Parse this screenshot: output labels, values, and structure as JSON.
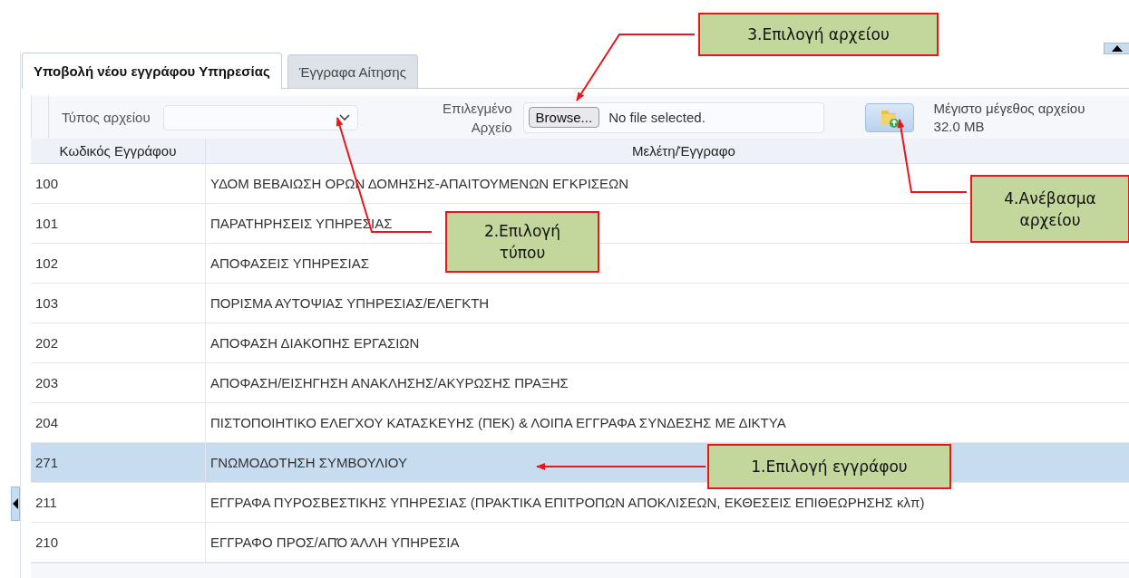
{
  "tabs": [
    {
      "label": "Υποβολή νέου εγγράφου Υπηρεσίας",
      "selected": true
    },
    {
      "label": "Έγγραφα Αίτησης",
      "selected": false
    }
  ],
  "toolbar": {
    "file_type_label": "Τύπος αρχείου",
    "selected_file_label": "Επιλεγμένο Αρχείο",
    "browse_button": "Browse...",
    "file_status": "No file selected.",
    "max_size_label": "Μέγιστο μέγεθος αρχείου",
    "max_size_value": "32.0 MB"
  },
  "table": {
    "columns": [
      "Κωδικός Εγγράφου",
      "Μελέτη/Έγγραφο"
    ],
    "rows": [
      {
        "code": "100",
        "document": "ΥΔΟΜ ΒΕΒΑΙΩΣΗ ΟΡΩΝ ΔΟΜΗΣΗΣ-ΑΠΑΙΤΟΥΜΕΝΩΝ ΕΓΚΡΙΣΕΩΝ",
        "selected": false
      },
      {
        "code": "101",
        "document": "ΠΑΡΑΤΗΡΗΣΕΙΣ ΥΠΗΡΕΣΙΑΣ",
        "selected": false
      },
      {
        "code": "102",
        "document": "ΑΠΟΦΑΣΕΙΣ ΥΠΗΡΕΣΙΑΣ",
        "selected": false
      },
      {
        "code": "103",
        "document": "ΠΟΡΙΣΜΑ ΑΥΤΟΨΙΑΣ ΥΠΗΡΕΣΙΑΣ/ΕΛΕΓΚΤΗ",
        "selected": false
      },
      {
        "code": "202",
        "document": "ΑΠΟΦΑΣΗ ΔΙΑΚΟΠΗΣ ΕΡΓΑΣΙΩΝ",
        "selected": false
      },
      {
        "code": "203",
        "document": "ΑΠΟΦΑΣΗ/ΕΙΣΗΓΗΣΗ ΑΝΑΚΛΗΣΗΣ/ΑΚΥΡΩΣΗΣ ΠΡΑΞΗΣ",
        "selected": false
      },
      {
        "code": "204",
        "document": "ΠΙΣΤΟΠΟΙΗΤΙΚΟ ΕΛΕΓΧΟΥ ΚΑΤΑΣΚΕΥΗΣ (ΠΕΚ) & ΛΟΙΠΑ ΕΓΓΡΑΦΑ ΣΥΝΔΕΣΗΣ ΜΕ ΔΙΚΤΥΑ",
        "selected": false
      },
      {
        "code": "271",
        "document": "ΓΝΩΜΟΔΟΤΗΣΗ ΣΥΜΒΟΥΛΙΟΥ",
        "selected": true
      },
      {
        "code": "211",
        "document": "ΕΓΓΡΑΦΑ ΠΥΡΟΣΒΕΣΤΙΚΗΣ ΥΠΗΡΕΣΙΑΣ (ΠΡΑΚΤΙΚΑ ΕΠΙΤΡΟΠΩΝ ΑΠΟΚΛΙΣΕΩΝ, ΕΚΘΕΣΕΙΣ ΕΠΙΘΕΩΡΗΣΗΣ κλπ)",
        "selected": false
      },
      {
        "code": "210",
        "document": "ΕΓΓΡΑΦΟ ΠΡΟΣ/ΑΠΌ ΆΛΛΗ ΥΠΗΡΕΣΙΑ",
        "selected": false
      }
    ]
  },
  "callouts": [
    "1.Επιλογή εγγράφου",
    "2.Επιλογή τύπου",
    "3.Επιλογή αρχείου",
    "4.Ανέβασμα αρχείου"
  ]
}
